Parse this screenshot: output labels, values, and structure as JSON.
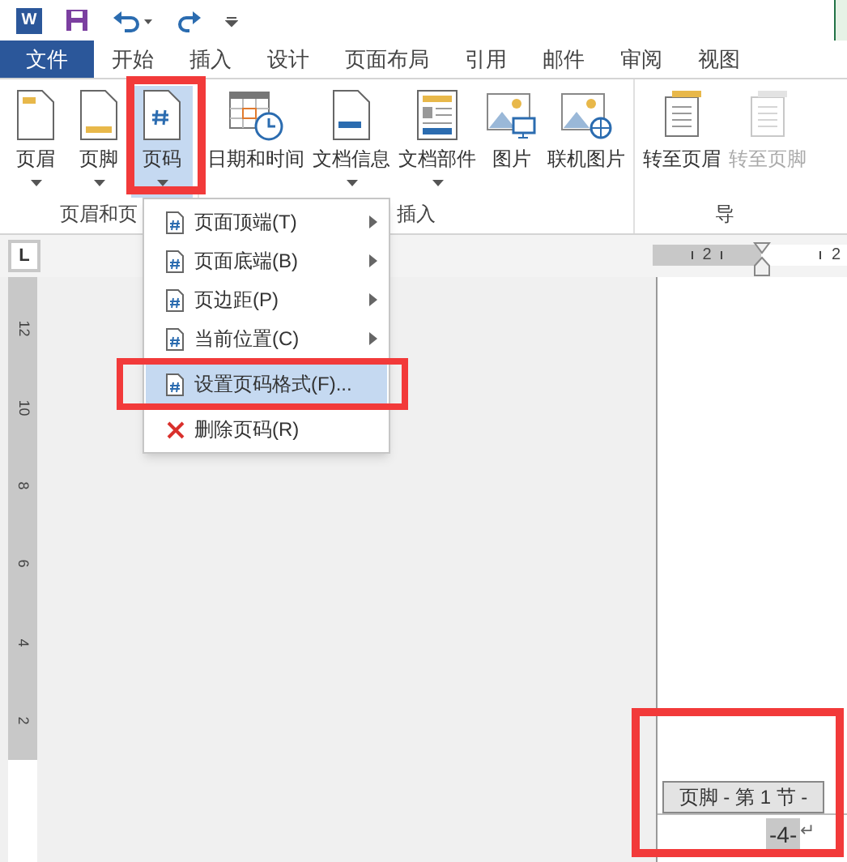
{
  "quick_access": {
    "app_icon": "W"
  },
  "tabs": [
    {
      "label": "文件",
      "kind": "file",
      "selected": false
    },
    {
      "label": "开始",
      "kind": "tab",
      "selected": false
    },
    {
      "label": "插入",
      "kind": "tab",
      "selected": false
    },
    {
      "label": "设计",
      "kind": "tab",
      "selected": false
    },
    {
      "label": "页面布局",
      "kind": "tab",
      "selected": false
    },
    {
      "label": "引用",
      "kind": "tab",
      "selected": false
    },
    {
      "label": "邮件",
      "kind": "tab",
      "selected": false
    },
    {
      "label": "审阅",
      "kind": "tab",
      "selected": false
    },
    {
      "label": "视图",
      "kind": "tab",
      "selected": false
    }
  ],
  "ribbon": {
    "groups": [
      {
        "label": "页眉和页",
        "buttons": [
          {
            "label": "页眉",
            "dropdown": true,
            "selected": false,
            "disabled": false
          },
          {
            "label": "页脚",
            "dropdown": true,
            "selected": false,
            "disabled": false
          },
          {
            "label": "页码",
            "dropdown": true,
            "selected": true,
            "disabled": false
          }
        ]
      },
      {
        "label": "插入",
        "buttons": [
          {
            "label": "日期和时间",
            "dropdown": false,
            "selected": false,
            "disabled": false
          },
          {
            "label": "文档信息",
            "dropdown": true,
            "selected": false,
            "disabled": false
          },
          {
            "label": "文档部件",
            "dropdown": true,
            "selected": false,
            "disabled": false
          },
          {
            "label": "图片",
            "dropdown": false,
            "selected": false,
            "disabled": false
          },
          {
            "label": "联机图片",
            "dropdown": false,
            "selected": false,
            "disabled": false
          }
        ]
      },
      {
        "label": "导",
        "buttons": [
          {
            "label": "转至页眉",
            "dropdown": false,
            "selected": false,
            "disabled": false
          },
          {
            "label": "转至页脚",
            "dropdown": false,
            "selected": false,
            "disabled": true
          }
        ]
      }
    ]
  },
  "menu": {
    "items": [
      {
        "label": "页面顶端(T)",
        "submenu": true,
        "selected": false
      },
      {
        "label": "页面底端(B)",
        "submenu": true,
        "selected": false
      },
      {
        "label": "页边距(P)",
        "submenu": true,
        "selected": false
      },
      {
        "label": "当前位置(C)",
        "submenu": true,
        "selected": false
      },
      {
        "label": "设置页码格式(F)...",
        "submenu": false,
        "selected": true
      },
      {
        "label": "删除页码(R)",
        "submenu": false,
        "selected": false
      }
    ]
  },
  "ruler": {
    "tab_selector": "L",
    "horizontal_labels": [
      "2",
      "2"
    ],
    "vertical_labels": [
      "12",
      "10",
      "8",
      "6",
      "4",
      "2"
    ]
  },
  "footer": {
    "tag": "页脚 - 第 1 节 -",
    "page_number": "-4-",
    "paragraph_mark": "↵"
  }
}
